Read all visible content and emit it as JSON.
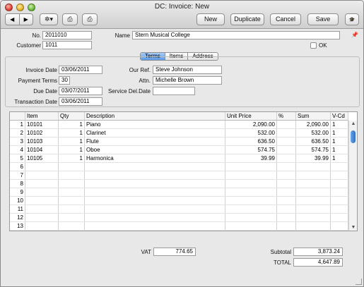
{
  "window": {
    "title": "DC: Invoice: New"
  },
  "toolbar": {
    "nav_prev": "◀",
    "nav_next": "▶",
    "actions_icon": "gear-icon",
    "actions_glyph": "✲▾",
    "print_icon": "printer-icon",
    "print_glyph": "⎙",
    "preview_icon": "print-preview-icon",
    "preview_glyph": "⎙",
    "new_label": "New",
    "duplicate_label": "Duplicate",
    "cancel_label": "Cancel",
    "save_label": "Save",
    "hat_icon": "graduation-cap-icon",
    "hat_glyph": "🎓"
  },
  "header": {
    "no_label": "No.",
    "no_value": "2011010",
    "customer_label": "Customer",
    "customer_value": "1011",
    "name_label": "Name",
    "name_value": "Stern Musical College",
    "ok_label": "OK",
    "pin_glyph": "📌"
  },
  "tabs": [
    {
      "label": "Terms",
      "active": true
    },
    {
      "label": "Items",
      "active": false
    },
    {
      "label": "Address",
      "active": false
    }
  ],
  "terms": {
    "invoice_date_label": "Invoice Date",
    "invoice_date_value": "03/06/2011",
    "payment_terms_label": "Payment Terms",
    "payment_terms_value": "30",
    "due_date_label": "Due Date",
    "due_date_value": "03/07/2011",
    "transaction_date_label": "Transaction Date",
    "transaction_date_value": "03/06/2011",
    "our_ref_label": "Our Ref.",
    "our_ref_value": "Steve Johnson",
    "attn_label": "Attn.",
    "attn_value": "Michelle Brown",
    "service_del_label": "Service Del.Date",
    "service_del_value": ""
  },
  "grid": {
    "headers": [
      "",
      "Item",
      "Qty",
      "Description",
      "Unit Price",
      "%",
      "Sum",
      "V-Cd"
    ],
    "rows": [
      [
        "1",
        "10101",
        "1",
        "Piano",
        "2,090.00",
        "",
        "2,090.00",
        "1"
      ],
      [
        "2",
        "10102",
        "1",
        "Clarinet",
        "532.00",
        "",
        "532.00",
        "1"
      ],
      [
        "3",
        "10103",
        "1",
        "Flute",
        "636.50",
        "",
        "636.50",
        "1"
      ],
      [
        "4",
        "10104",
        "1",
        "Oboe",
        "574.75",
        "",
        "574.75",
        "1"
      ],
      [
        "5",
        "10105",
        "1",
        "Harmonica",
        "39.99",
        "",
        "39.99",
        "1"
      ],
      [
        "6",
        "",
        "",
        "",
        "",
        "",
        "",
        ""
      ],
      [
        "7",
        "",
        "",
        "",
        "",
        "",
        "",
        ""
      ],
      [
        "8",
        "",
        "",
        "",
        "",
        "",
        "",
        ""
      ],
      [
        "9",
        "",
        "",
        "",
        "",
        "",
        "",
        ""
      ],
      [
        "10",
        "",
        "",
        "",
        "",
        "",
        "",
        ""
      ],
      [
        "11",
        "",
        "",
        "",
        "",
        "",
        "",
        ""
      ],
      [
        "12",
        "",
        "",
        "",
        "",
        "",
        "",
        ""
      ],
      [
        "13",
        "",
        "",
        "",
        "",
        "",
        "",
        ""
      ]
    ]
  },
  "footer": {
    "vat_label": "VAT",
    "vat_value": "774.65",
    "subtotal_label": "Subtotal",
    "subtotal_value": "3,873.24",
    "total_label": "TOTAL",
    "total_value": "4,647.89"
  }
}
